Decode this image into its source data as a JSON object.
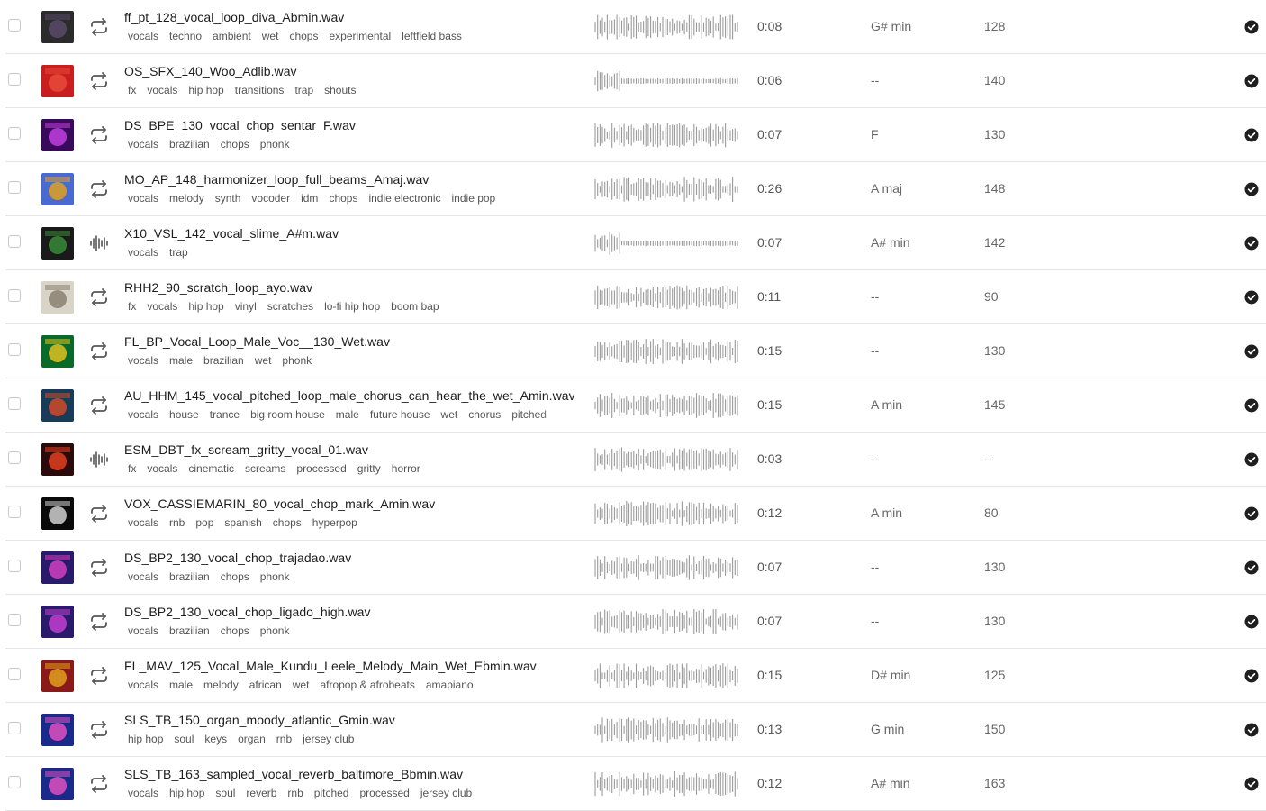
{
  "rows": [
    {
      "filename": "ff_pt_128_vocal_loop_diva_Abmin.wav",
      "tags": [
        "vocals",
        "techno",
        "ambient",
        "wet",
        "chops",
        "experimental",
        "leftfield bass"
      ],
      "duration": "0:08",
      "key": "G# min",
      "bpm": "128",
      "type": "loop",
      "art": [
        "#2b2b2b",
        "#5a4a6a"
      ]
    },
    {
      "filename": "OS_SFX_140_Woo_Adlib.wav",
      "tags": [
        "fx",
        "vocals",
        "hip hop",
        "transitions",
        "trap",
        "shouts"
      ],
      "duration": "0:06",
      "key": "--",
      "bpm": "140",
      "type": "loop",
      "art": [
        "#c81e1e",
        "#e64a3a"
      ]
    },
    {
      "filename": "DS_BPE_130_vocal_chop_sentar_F.wav",
      "tags": [
        "vocals",
        "brazilian",
        "chops",
        "phonk"
      ],
      "duration": "0:07",
      "key": "F",
      "bpm": "130",
      "type": "loop",
      "art": [
        "#3a0a5a",
        "#c040e0"
      ]
    },
    {
      "filename": "MO_AP_148_harmonizer_loop_full_beams_Amaj.wav",
      "tags": [
        "vocals",
        "melody",
        "synth",
        "vocoder",
        "idm",
        "chops",
        "indie electronic",
        "indie pop"
      ],
      "duration": "0:26",
      "key": "A maj",
      "bpm": "148",
      "type": "loop",
      "art": [
        "#4a6ad0",
        "#e0a020"
      ]
    },
    {
      "filename": "X10_VSL_142_vocal_slime_A#m.wav",
      "tags": [
        "vocals",
        "trap"
      ],
      "duration": "0:07",
      "key": "A# min",
      "bpm": "142",
      "type": "oneshot",
      "art": [
        "#1a1a1a",
        "#3a8a3a"
      ]
    },
    {
      "filename": "RHH2_90_scratch_loop_ayo.wav",
      "tags": [
        "fx",
        "vocals",
        "hip hop",
        "vinyl",
        "scratches",
        "lo-fi hip hop",
        "boom bap"
      ],
      "duration": "0:11",
      "key": "--",
      "bpm": "90",
      "type": "loop",
      "art": [
        "#d8d4c8",
        "#8a8070"
      ]
    },
    {
      "filename": "FL_BP_Vocal_Loop_Male_Voc__130_Wet.wav",
      "tags": [
        "vocals",
        "male",
        "brazilian",
        "wet",
        "phonk"
      ],
      "duration": "0:15",
      "key": "--",
      "bpm": "130",
      "type": "loop",
      "art": [
        "#0a6a2a",
        "#e0c020"
      ]
    },
    {
      "filename": "AU_HHM_145_vocal_pitched_loop_male_chorus_can_hear_the_wet_Amin.wav",
      "tags": [
        "vocals",
        "house",
        "trance",
        "big room house",
        "male",
        "future house",
        "wet",
        "chorus",
        "pitched"
      ],
      "duration": "0:15",
      "key": "A min",
      "bpm": "145",
      "type": "loop",
      "art": [
        "#1a3a5a",
        "#d04a2a"
      ]
    },
    {
      "filename": "ESM_DBT_fx_scream_gritty_vocal_01.wav",
      "tags": [
        "fx",
        "vocals",
        "cinematic",
        "screams",
        "processed",
        "gritty",
        "horror"
      ],
      "duration": "0:03",
      "key": "--",
      "bpm": "--",
      "type": "oneshot",
      "art": [
        "#2a0a0a",
        "#e04020"
      ]
    },
    {
      "filename": "VOX_CASSIEMARIN_80_vocal_chop_mark_Amin.wav",
      "tags": [
        "vocals",
        "rnb",
        "pop",
        "spanish",
        "chops",
        "hyperpop"
      ],
      "duration": "0:12",
      "key": "A min",
      "bpm": "80",
      "type": "loop",
      "art": [
        "#0a0a0a",
        "#d0d0d0"
      ]
    },
    {
      "filename": "DS_BP2_130_vocal_chop_trajadao.wav",
      "tags": [
        "vocals",
        "brazilian",
        "chops",
        "phonk"
      ],
      "duration": "0:07",
      "key": "--",
      "bpm": "130",
      "type": "loop",
      "art": [
        "#2a1a6a",
        "#d040c0"
      ]
    },
    {
      "filename": "DS_BP2_130_vocal_chop_ligado_high.wav",
      "tags": [
        "vocals",
        "brazilian",
        "chops",
        "phonk"
      ],
      "duration": "0:07",
      "key": "--",
      "bpm": "130",
      "type": "loop",
      "art": [
        "#2a1a6a",
        "#c040d0"
      ]
    },
    {
      "filename": "FL_MAV_125_Vocal_Male_Kundu_Leele_Melody_Main_Wet_Ebmin.wav",
      "tags": [
        "vocals",
        "male",
        "melody",
        "african",
        "wet",
        "afropop & afrobeats",
        "amapiano"
      ],
      "duration": "0:15",
      "key": "D# min",
      "bpm": "125",
      "type": "loop",
      "art": [
        "#8a1a1a",
        "#e0a020"
      ]
    },
    {
      "filename": "SLS_TB_150_organ_moody_atlantic_Gmin.wav",
      "tags": [
        "hip hop",
        "soul",
        "keys",
        "organ",
        "rnb",
        "jersey club"
      ],
      "duration": "0:13",
      "key": "G min",
      "bpm": "150",
      "type": "loop",
      "art": [
        "#1a2a8a",
        "#e050c0"
      ]
    },
    {
      "filename": "SLS_TB_163_sampled_vocal_reverb_baltimore_Bbmin.wav",
      "tags": [
        "vocals",
        "hip hop",
        "soul",
        "reverb",
        "rnb",
        "pitched",
        "processed",
        "jersey club"
      ],
      "duration": "0:12",
      "key": "A# min",
      "bpm": "163",
      "type": "loop",
      "art": [
        "#1a2a8a",
        "#e050c0"
      ]
    }
  ]
}
